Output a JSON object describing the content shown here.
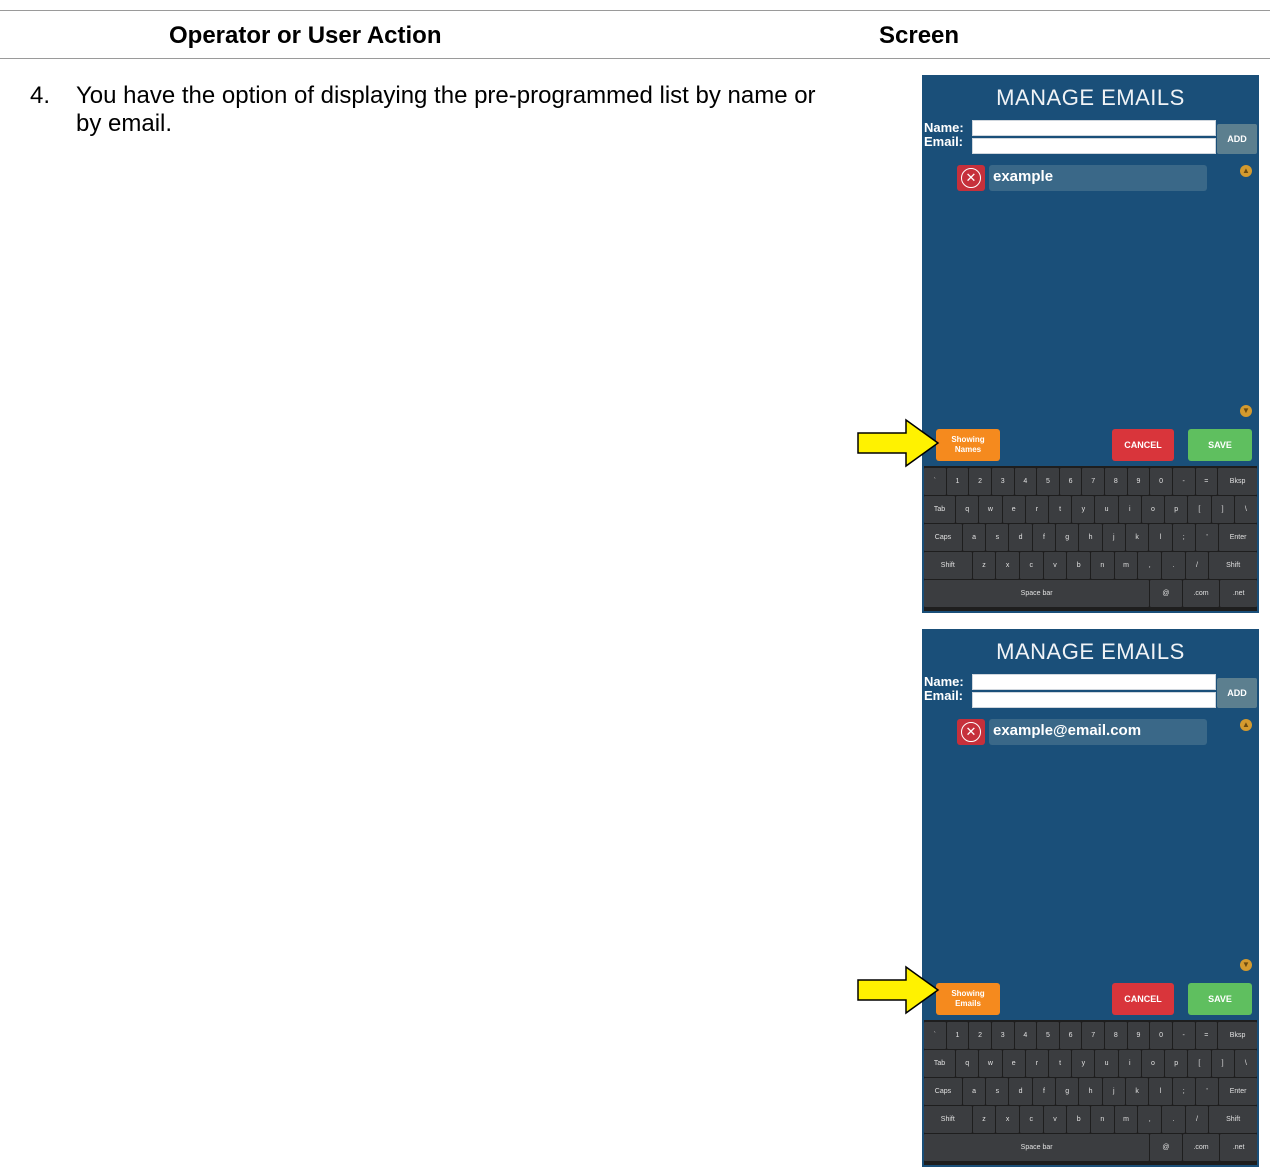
{
  "header": {
    "col1": "Operator or User Action",
    "col2": "Screen"
  },
  "step": {
    "number": "4.",
    "text": "You have the option of displaying the pre-programmed list by name or by email."
  },
  "screens": [
    {
      "title": "MANAGE EMAILS",
      "name_label": "Name:",
      "email_label": "Email:",
      "add_label": "ADD",
      "list_item": "example",
      "toggle_line1": "Showing",
      "toggle_line2": "Names",
      "cancel_label": "CANCEL",
      "save_label": "SAVE"
    },
    {
      "title": "MANAGE EMAILS",
      "name_label": "Name:",
      "email_label": "Email:",
      "add_label": "ADD",
      "list_item": "example@email.com",
      "toggle_line1": "Showing",
      "toggle_line2": "Emails",
      "cancel_label": "CANCEL",
      "save_label": "SAVE"
    }
  ],
  "keyboard": {
    "rows": [
      [
        "`",
        "1",
        "2",
        "3",
        "4",
        "5",
        "6",
        "7",
        "8",
        "9",
        "0",
        "-",
        "=",
        "Bksp"
      ],
      [
        "Tab",
        "q",
        "w",
        "e",
        "r",
        "t",
        "y",
        "u",
        "i",
        "o",
        "p",
        "[",
        "]",
        "\\"
      ],
      [
        "Caps",
        "a",
        "s",
        "d",
        "f",
        "g",
        "h",
        "j",
        "k",
        "l",
        ";",
        "'",
        "Enter"
      ],
      [
        "Shift",
        "z",
        "x",
        "c",
        "v",
        "b",
        "n",
        "m",
        ",",
        ".",
        "/",
        "Shift"
      ],
      [
        "Space bar",
        "@",
        ".com",
        ".net"
      ]
    ]
  },
  "colors": {
    "screen_bg": "#1a4f79",
    "toggle": "#f58a1e",
    "cancel": "#d9353b",
    "save": "#5fbf5f",
    "arrow": "#fff200"
  },
  "icons": {
    "delete": "close-circle-icon",
    "scroll": "scroll-indicator-icon",
    "pointer": "arrow-right-icon"
  }
}
